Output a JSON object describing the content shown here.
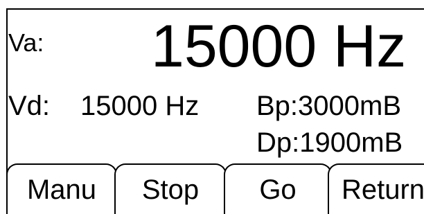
{
  "display": {
    "va_label": "Va:",
    "va_value": "15000 Hz",
    "vd_label": "Vd:",
    "vd_value": "15000 Hz",
    "bp_value": "Bp:3000mB",
    "dp_value": "Dp:1900mB"
  },
  "softkeys": [
    {
      "label": "Manu"
    },
    {
      "label": "Stop"
    },
    {
      "label": "Go"
    },
    {
      "label": "Return"
    }
  ]
}
